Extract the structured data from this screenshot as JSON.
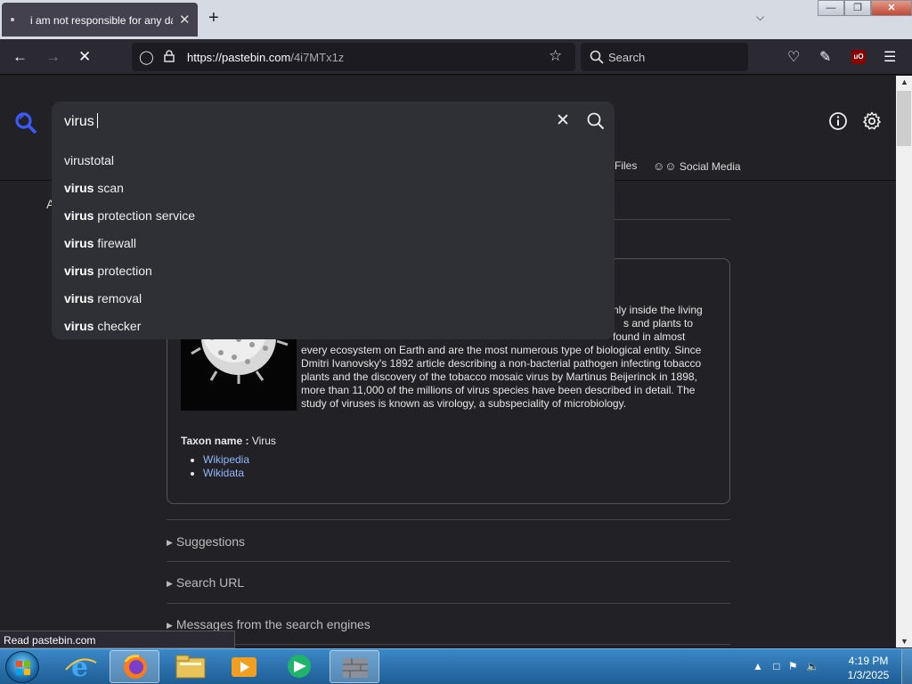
{
  "browser": {
    "tab_title": "i am not responsible for any da",
    "url_domain": "https://pastebin.com",
    "url_path": "/4i7MTx1z",
    "search_placeholder": "Search",
    "status_text": "Read pastebin.com"
  },
  "search": {
    "query": "virus",
    "suggestions": [
      {
        "bold": "",
        "rest": "virustotal"
      },
      {
        "bold": "virus",
        "rest": " scan"
      },
      {
        "bold": "virus",
        "rest": " protection service"
      },
      {
        "bold": "virus",
        "rest": " firewall"
      },
      {
        "bold": "virus",
        "rest": " protection"
      },
      {
        "bold": "virus",
        "rest": " removal"
      },
      {
        "bold": "virus",
        "rest": " checker"
      }
    ]
  },
  "categories": {
    "files": "Files",
    "social_media": "Social Media"
  },
  "left_letter": "A",
  "infobox": {
    "text_line1": "nly inside the living",
    "text_line2": "s and plants to",
    "text_line3": "found in almost",
    "text_line4": "every ecosystem on Earth and are the most numerous type of biological entity. Since Dmitri Ivanovsky's 1892 article describing a non-bacterial pathogen infecting tobacco plants and the discovery of the tobacco mosaic virus by Martinus Beijerinck in 1898, more than 11,000 of the millions of virus species have been described in detail. The study of viruses is known as virology, a subspeciality of microbiology.",
    "taxon_label": "Taxon name :",
    "taxon_value": "Virus",
    "links": [
      "Wikipedia",
      "Wikidata"
    ]
  },
  "accordions": [
    "Suggestions",
    "Search URL",
    "Messages from the search engines"
  ],
  "taskbar": {
    "time": "4:19 PM",
    "date": "1/3/2025"
  },
  "colors": {
    "accent_blue": "#3b5bff",
    "link": "#8fb8ff",
    "page_bg": "#222226"
  }
}
